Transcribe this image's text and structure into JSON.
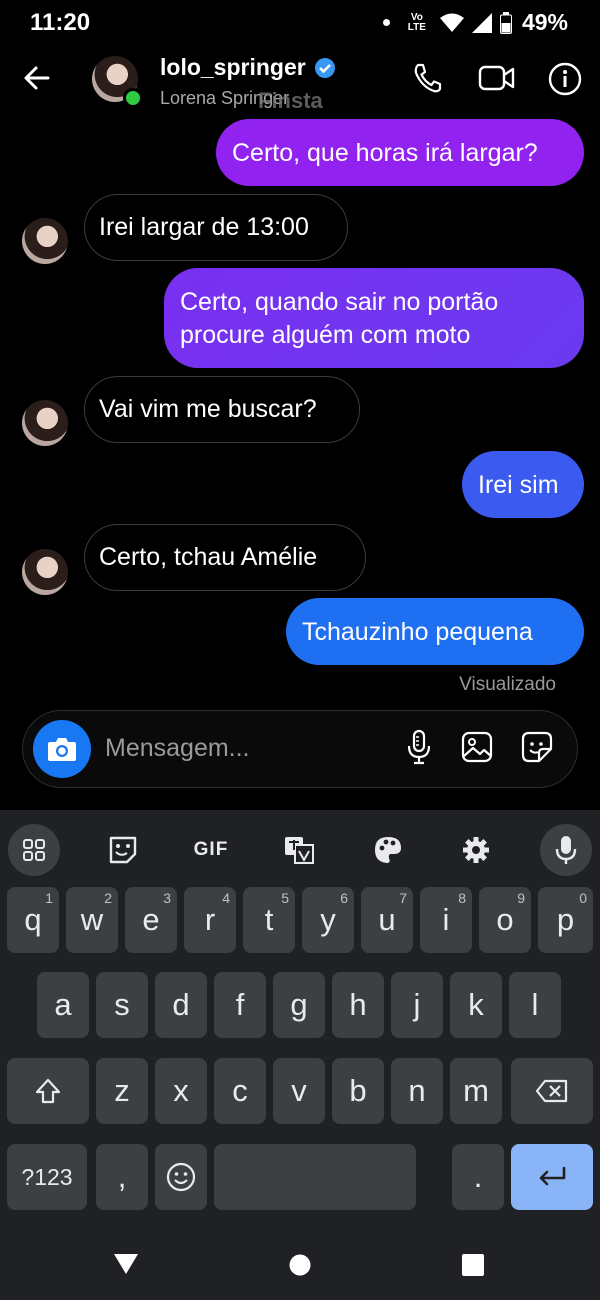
{
  "status_bar": {
    "time": "11:20",
    "volte_top": "Vo",
    "volte_bottom": "LTE",
    "battery": "49%"
  },
  "header": {
    "username": "lolo_springer",
    "subname": "Lorena Springer",
    "ghost_text": "Finsta"
  },
  "messages": [
    {
      "from": "me",
      "text": "Certo, que horas irá largar?"
    },
    {
      "from": "them",
      "text": "Irei largar de 13:00"
    },
    {
      "from": "me",
      "text": "Certo, quando sair no portão procure alguém com moto"
    },
    {
      "from": "them",
      "text": "Vai vim me buscar?"
    },
    {
      "from": "me",
      "text": "Irei sim"
    },
    {
      "from": "them",
      "text": "Certo, tchau Amélie"
    },
    {
      "from": "me",
      "text": "Tchauzinho pequena"
    }
  ],
  "seen_label": "Visualizado",
  "composer": {
    "placeholder": "Mensagem..."
  },
  "keyboard": {
    "toolbar": {
      "gif": "GIF"
    },
    "row1": [
      {
        "k": "q",
        "h": "1"
      },
      {
        "k": "w",
        "h": "2"
      },
      {
        "k": "e",
        "h": "3"
      },
      {
        "k": "r",
        "h": "4"
      },
      {
        "k": "t",
        "h": "5"
      },
      {
        "k": "y",
        "h": "6"
      },
      {
        "k": "u",
        "h": "7"
      },
      {
        "k": "i",
        "h": "8"
      },
      {
        "k": "o",
        "h": "9"
      },
      {
        "k": "p",
        "h": "0"
      }
    ],
    "row2": [
      "a",
      "s",
      "d",
      "f",
      "g",
      "h",
      "j",
      "k",
      "l"
    ],
    "row3": [
      "z",
      "x",
      "c",
      "v",
      "b",
      "n",
      "m"
    ],
    "symbols": "?123",
    "comma": ",",
    "period": "."
  },
  "colors": {
    "bubble_purple": "#9b22f0",
    "bubble_violet": "#6a3bf0",
    "bubble_blue": "#3a5af0",
    "bubble_blue2": "#1877f2",
    "verified": "#3897f0",
    "enter_key": "#8ab4f8"
  }
}
